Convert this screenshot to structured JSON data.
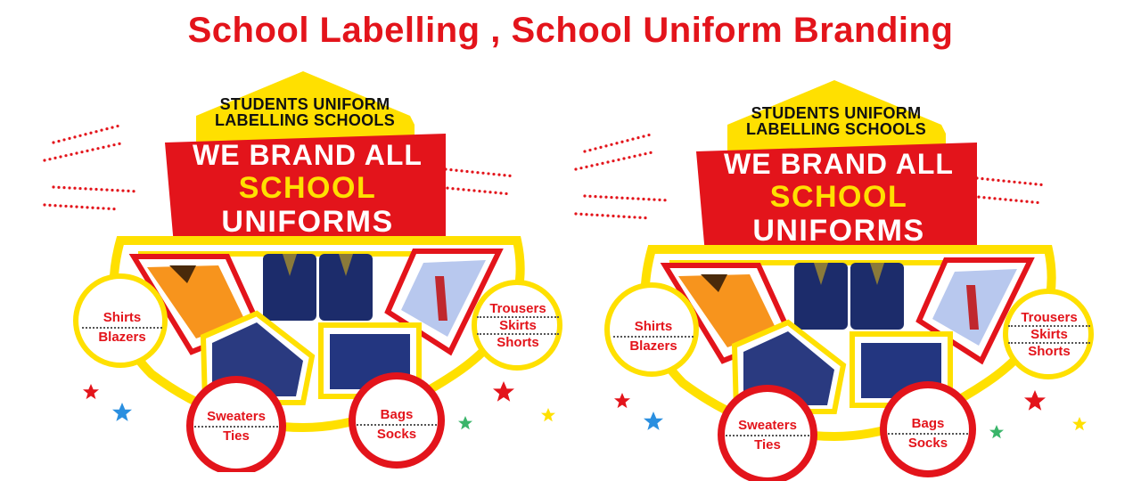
{
  "page_title": "School Labelling , School Uniform Branding",
  "poster": {
    "tag_line1": "STUDENTS UNIFORM",
    "tag_line2": "LABELLING SCHOOLS",
    "headline1": "WE BRAND ALL",
    "headline2": "SCHOOL",
    "headline3": "UNIFORMS",
    "circle_left": [
      "Shirts",
      "Blazers"
    ],
    "circle_right": [
      "Trousers",
      "Skirts",
      "Shorts"
    ],
    "circle_bottom_left": [
      "Sweaters",
      "Ties"
    ],
    "circle_bottom_right": [
      "Bags",
      "Socks"
    ],
    "colors": {
      "red": "#e3141b",
      "yellow": "#ffe000",
      "navy": "#1c2c6b",
      "orange": "#f7941d"
    }
  }
}
